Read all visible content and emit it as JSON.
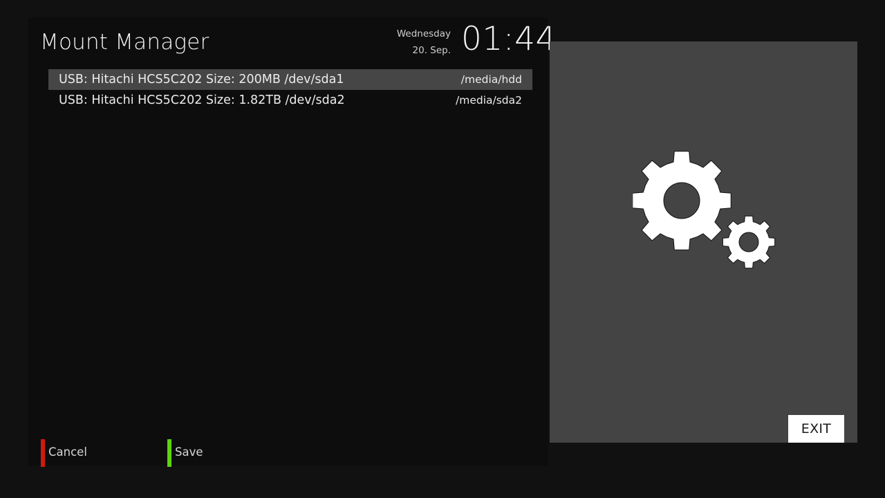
{
  "header": {
    "title": "Mount Manager",
    "day": "Wednesday",
    "date": "20. Sep.",
    "time": "01:44"
  },
  "mounts": [
    {
      "device": "USB: Hitachi HCS5C202 Size: 200MB /dev/sda1",
      "path": "/media/hdd",
      "selected": true
    },
    {
      "device": "USB: Hitachi HCS5C202 Size: 1.82TB /dev/sda2",
      "path": "/media/sda2",
      "selected": false
    }
  ],
  "keys": {
    "red": {
      "label": "Cancel",
      "color": "#d11a0e"
    },
    "green": {
      "label": "Save",
      "color": "#5ed40c"
    }
  },
  "side": {
    "icon": "gears-icon",
    "exit_label": "EXIT"
  },
  "colors": {
    "background": "#111111",
    "selection": "#464646",
    "side_panel": "#444444"
  }
}
